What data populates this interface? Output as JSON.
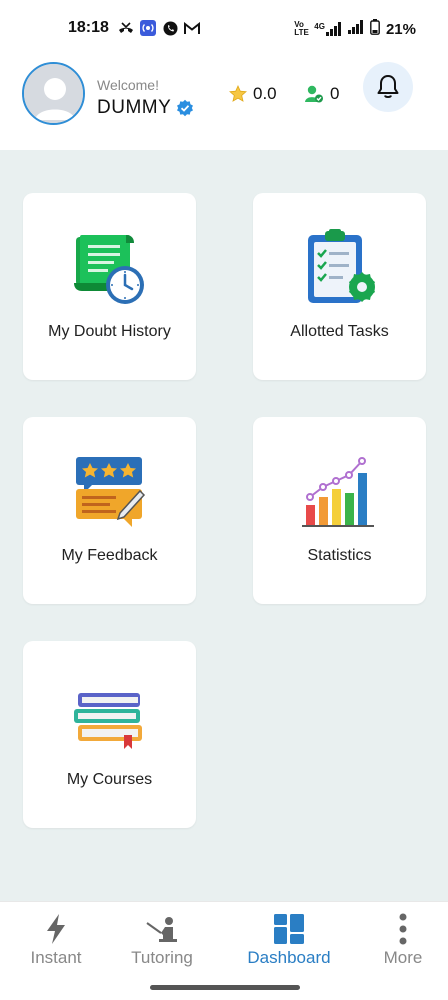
{
  "status_bar": {
    "time": "18:18",
    "battery": "21%",
    "network_badge": "4G",
    "volte": "Vo LTE"
  },
  "header": {
    "welcome": "Welcome!",
    "username": "DUMMY",
    "rating": "0.0",
    "connections": "0"
  },
  "cards": [
    {
      "label": "My Doubt History",
      "icon": "doubt-history-icon"
    },
    {
      "label": "Allotted Tasks",
      "icon": "clipboard-tasks-icon"
    },
    {
      "label": "My Feedback",
      "icon": "feedback-icon"
    },
    {
      "label": "Statistics",
      "icon": "statistics-chart-icon"
    },
    {
      "label": "My Courses",
      "icon": "books-icon"
    }
  ],
  "bottom_nav": [
    {
      "label": "Instant",
      "icon": "lightning-icon"
    },
    {
      "label": "Tutoring",
      "icon": "tutor-icon"
    },
    {
      "label": "Dashboard",
      "icon": "dashboard-grid-icon",
      "active": true
    },
    {
      "label": "More",
      "icon": "more-vertical-icon"
    }
  ],
  "colors": {
    "accent": "#2a7ec4",
    "background": "#e9f0f0",
    "card": "#ffffff",
    "inactive_nav": "#888888"
  }
}
